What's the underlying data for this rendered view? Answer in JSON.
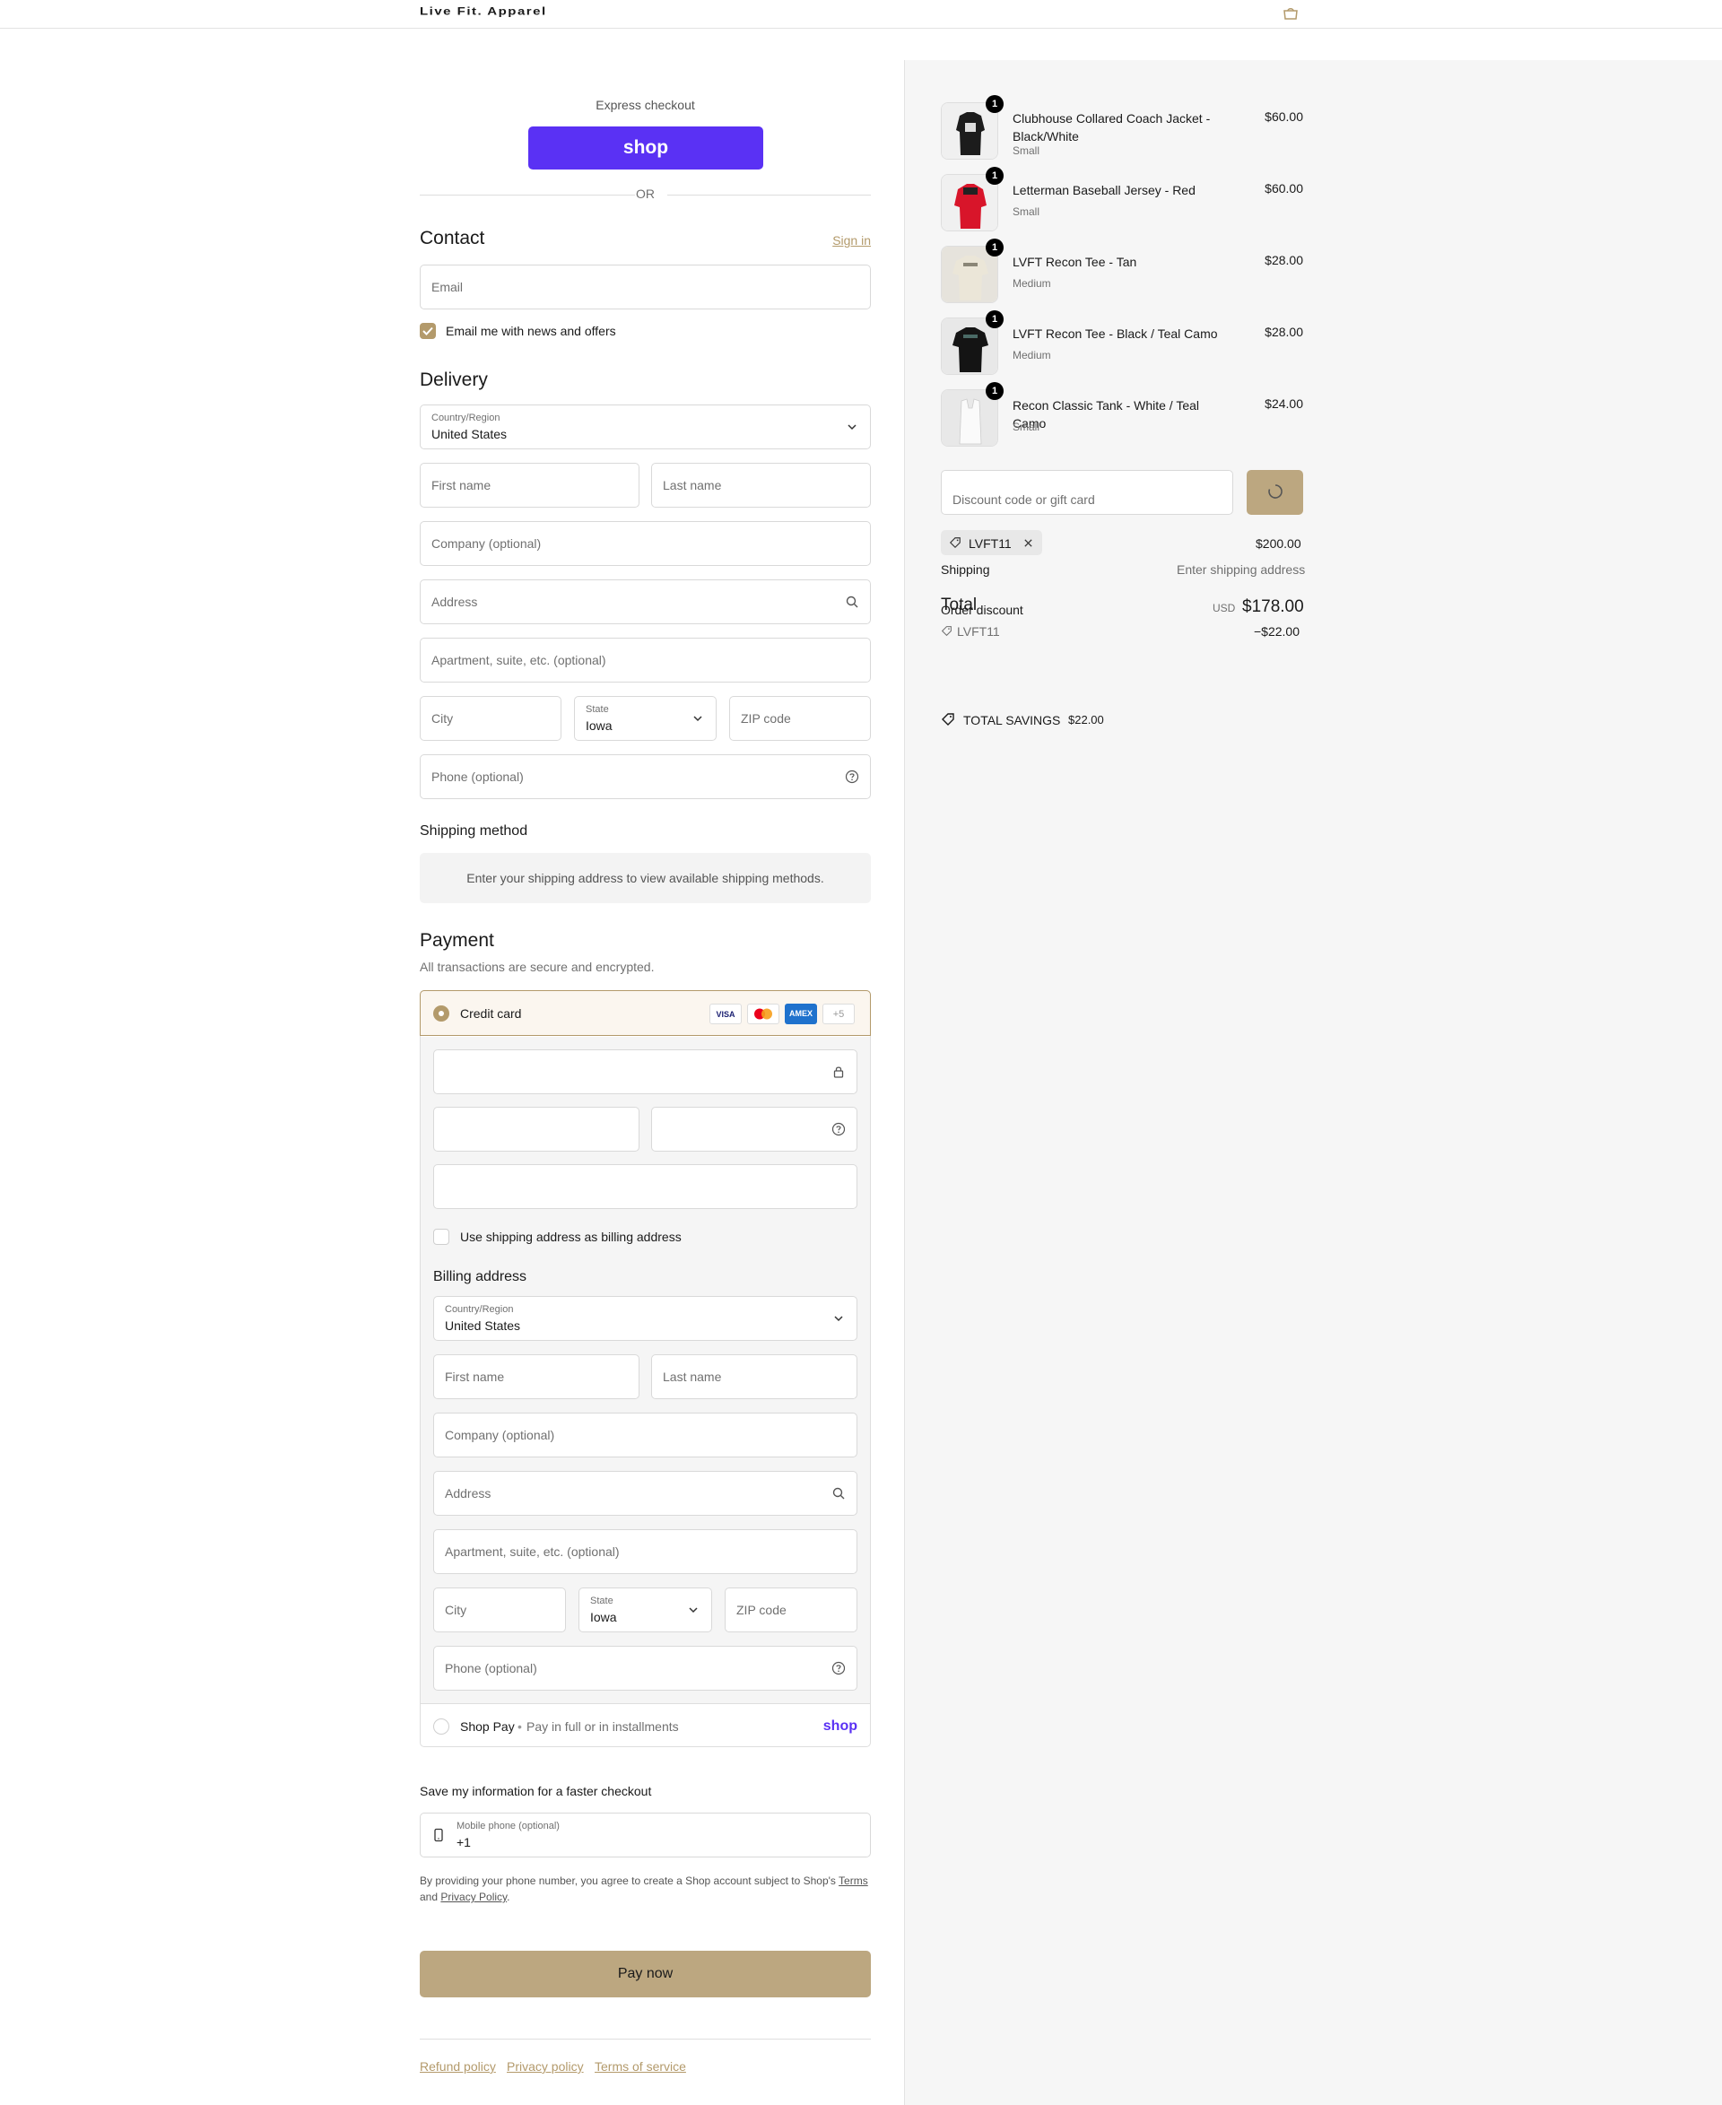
{
  "header": {
    "brand": "Live Fit. Apparel",
    "cart_icon": "shopping-bag-icon"
  },
  "express": {
    "title": "Express checkout",
    "shop_label": "shop",
    "or_label": "OR"
  },
  "contact": {
    "title": "Contact",
    "sign_in": "Sign in",
    "email_placeholder": "Email",
    "news_label": "Email me with news and offers",
    "news_checked": true
  },
  "delivery": {
    "title": "Delivery",
    "country_label": "Country/Region",
    "country_value": "United States",
    "first_name": "First name",
    "last_name": "Last name",
    "company": "Company (optional)",
    "address": "Address",
    "apartment": "Apartment, suite, etc. (optional)",
    "city": "City",
    "state_label": "State",
    "state_value": "Iowa",
    "zip": "ZIP code",
    "phone": "Phone (optional)"
  },
  "shipping_method": {
    "title": "Shipping method",
    "message": "Enter your shipping address to view available shipping methods."
  },
  "payment": {
    "title": "Payment",
    "subtitle": "All transactions are secure and encrypted.",
    "credit_card_label": "Credit card",
    "card_brands": [
      "VISA",
      "",
      "AMEX",
      "+5"
    ],
    "use_shipping_label": "Use shipping address as billing address",
    "billing_title": "Billing address",
    "billing": {
      "country_label": "Country/Region",
      "country_value": "United States",
      "first_name": "First name",
      "last_name": "Last name",
      "company": "Company (optional)",
      "address": "Address",
      "apartment": "Apartment, suite, etc. (optional)",
      "city": "City",
      "state_label": "State",
      "state_value": "Iowa",
      "zip": "ZIP code",
      "phone": "Phone (optional)"
    },
    "shop_pay_label": "Shop Pay",
    "shop_pay_sub": "Pay in full or in installments",
    "shop_pay_logo": "shop"
  },
  "save_info": {
    "title": "Save my information for a faster checkout",
    "mobile_label": "Mobile phone (optional)",
    "mobile_value": "+1",
    "legal_pre": "By providing your phone number, you agree to create a Shop account subject to Shop's",
    "terms": "Terms",
    "and": "and",
    "privacy": "Privacy Policy",
    "period": "."
  },
  "pay_now": "Pay now",
  "footer": {
    "refund": "Refund policy",
    "privacy": "Privacy policy",
    "terms": "Terms of service"
  },
  "summary": {
    "items": [
      {
        "name": "Clubhouse Collared Coach Jacket - Black/White",
        "variant": "Small",
        "price": "$60.00",
        "qty": "1"
      },
      {
        "name": "Letterman Baseball Jersey - Red",
        "variant": "Small",
        "price": "$60.00",
        "qty": "1"
      },
      {
        "name": "LVFT Recon Tee - Tan",
        "variant": "Medium",
        "price": "$28.00",
        "qty": "1"
      },
      {
        "name": "LVFT Recon Tee - Black / Teal Camo",
        "variant": "Medium",
        "price": "$28.00",
        "qty": "1"
      },
      {
        "name": "Recon Classic Tank - White / Teal Camo",
        "variant": "Small",
        "price": "$24.00",
        "qty": "1"
      }
    ],
    "discount_placeholder": "Discount code or gift card",
    "applied_code": "LVFT11",
    "subtotal_value": "$200.00",
    "shipping_label": "Shipping",
    "shipping_value": "Enter shipping address",
    "total_label": "Total",
    "order_discount_label": "Order discount",
    "currency": "USD",
    "total_value": "$178.00",
    "discount_code": "LVFT11",
    "discount_value": "−$22.00",
    "savings_label": "TOTAL SAVINGS",
    "savings_value": "$22.00"
  },
  "colors": {
    "accent": "#b39a6b",
    "button": "#bca780",
    "shop_purple": "#5a31f4"
  }
}
